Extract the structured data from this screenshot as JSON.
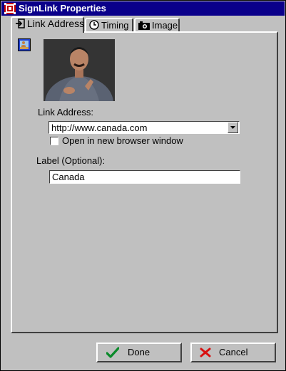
{
  "window": {
    "title": "SignLink Properties"
  },
  "tabs": [
    {
      "label": "Link Address",
      "icon": "link-in-icon",
      "active": true
    },
    {
      "label": "Timing",
      "icon": "clock-icon",
      "active": false
    },
    {
      "label": "Image",
      "icon": "camera-icon",
      "active": false
    }
  ],
  "link_address": {
    "label": "Link Address:",
    "value": "http://www.canada.com",
    "open_new_window_label": "Open in new browser window",
    "open_new_window_checked": false
  },
  "label_field": {
    "label": "Label (Optional):",
    "value": "Canada"
  },
  "buttons": {
    "done": "Done",
    "cancel": "Cancel"
  },
  "colors": {
    "titlebar": "#0a008a",
    "face": "#c0c0c0"
  }
}
